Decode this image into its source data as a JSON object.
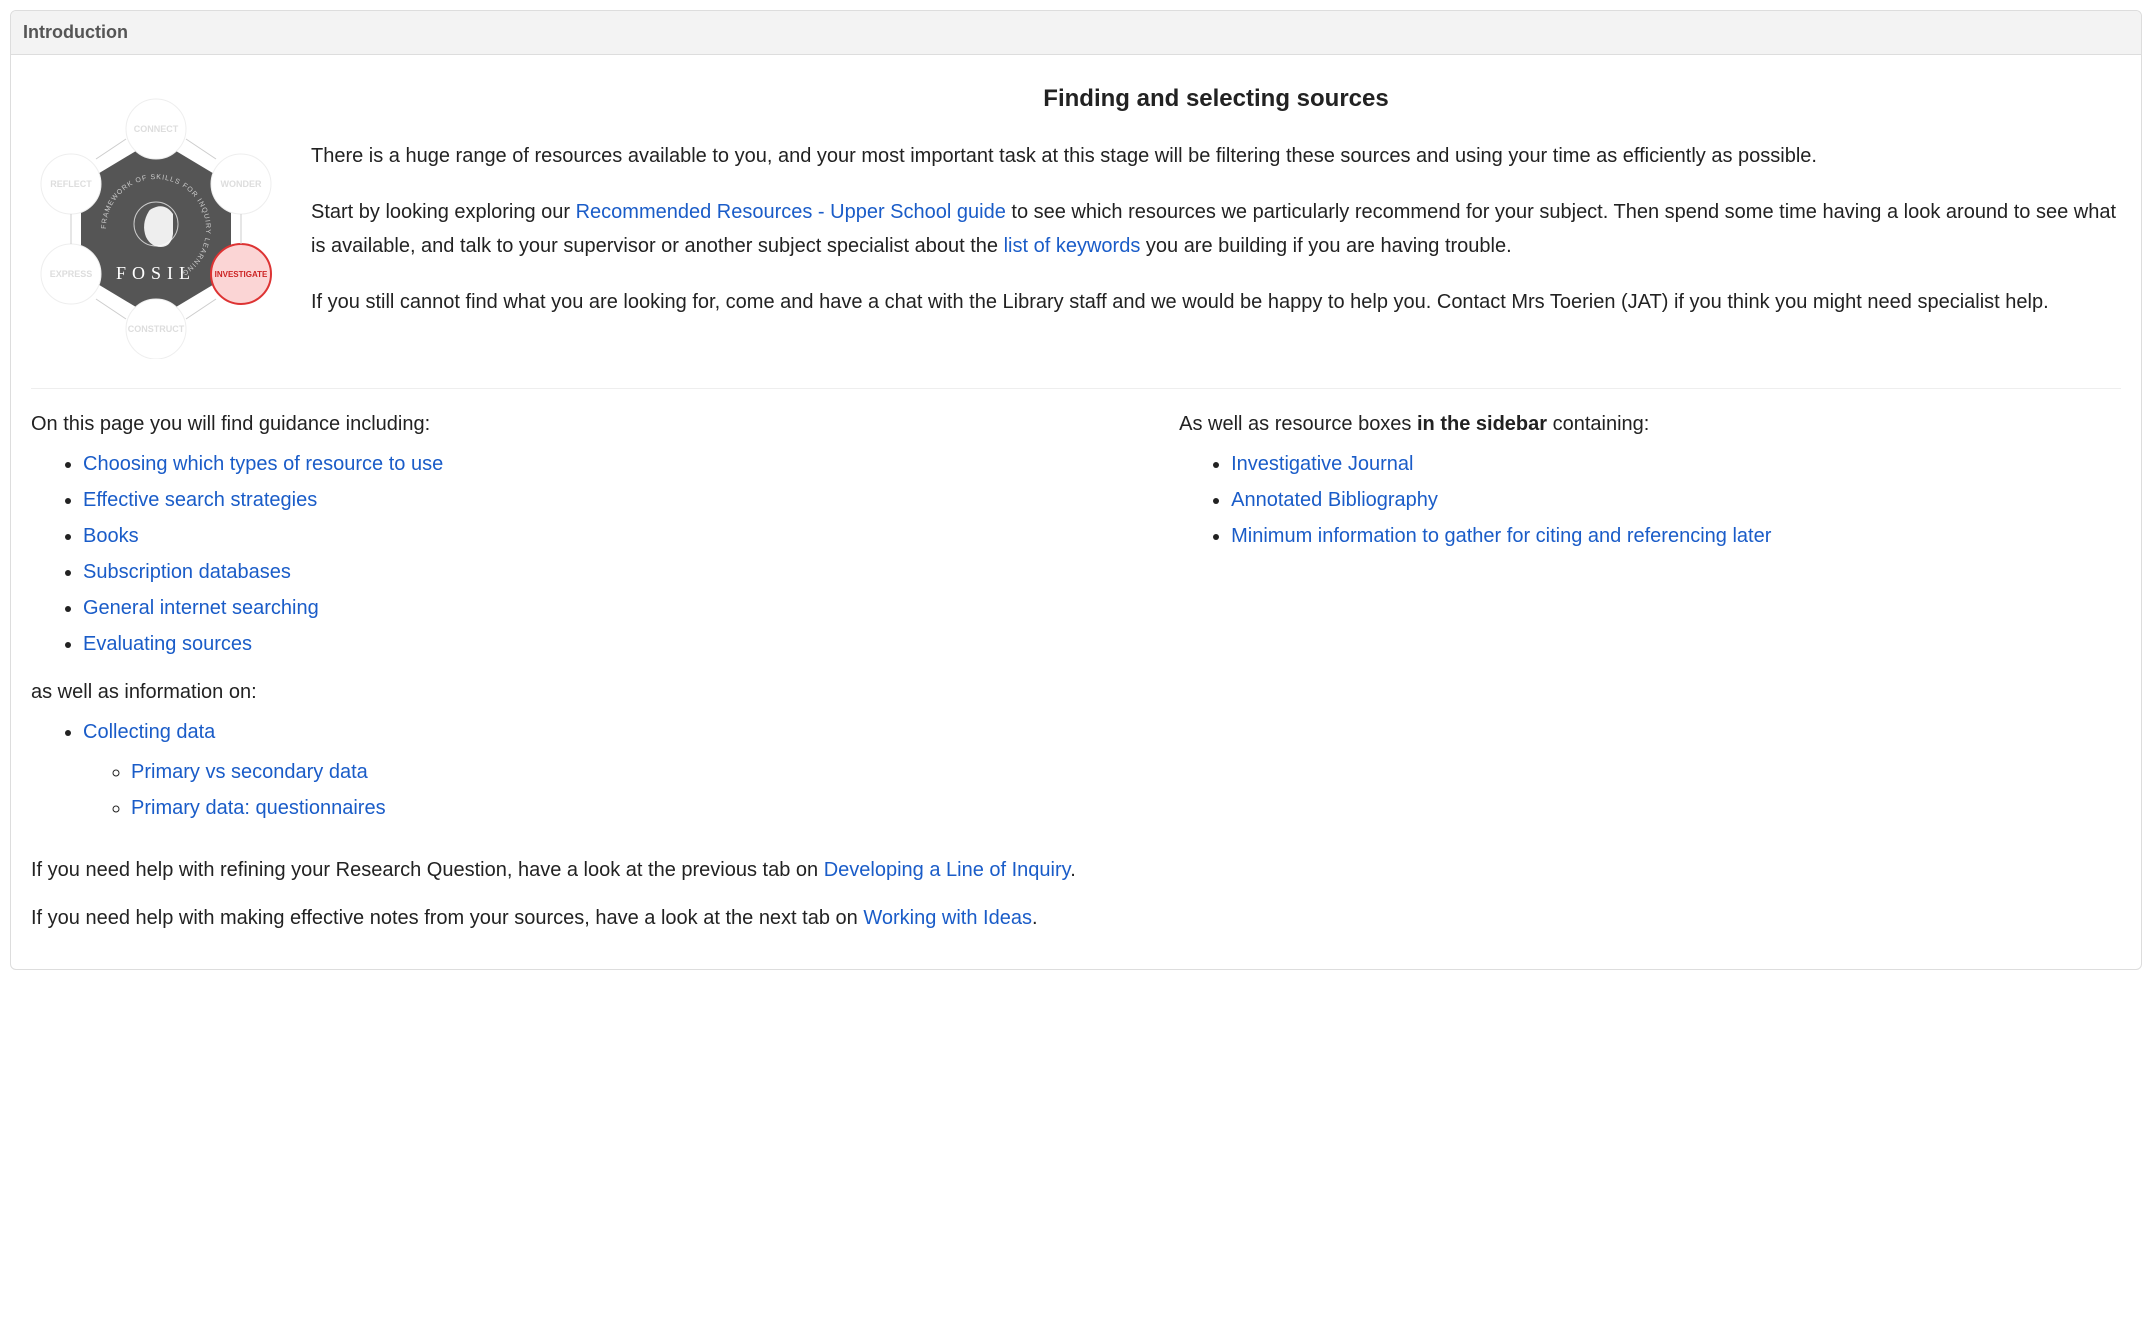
{
  "panel": {
    "title": "Introduction"
  },
  "heading": "Finding and selecting sources",
  "para1": "There is a huge range of resources available to you, and your most important task at this stage will be filtering these sources and using your time as efficiently as possible.",
  "para2a": "Start by looking exploring our ",
  "link_rec": "Recommended Resources - Upper School guide",
  "para2b": " to see which resources we particularly recommend for your subject. Then spend some time having a look around to see what is available, and talk to your supervisor or another subject specialist about the ",
  "link_keywords": "list of keywords",
  "para2c": " you are building if you are having trouble.",
  "para3": "If you still cannot find what you are looking for, come and have a chat with the Library staff and we would be happy to help you. Contact Mrs Toerien (JAT) if you think you might need specialist help.",
  "leftcol": {
    "intro1": "On this page you will find guidance including:",
    "links1": [
      "Choosing which types of resource to use",
      "Effective search strategies",
      "Books",
      "Subscription databases",
      "General internet searching",
      "Evaluating sources"
    ],
    "intro2": "as well as information on:",
    "links2_parent": "Collecting data",
    "links2_children": [
      "Primary vs secondary data",
      "Primary data: questionnaires"
    ]
  },
  "rightcol": {
    "intro_a": "As well as resource boxes ",
    "intro_b": "in the sidebar",
    "intro_c": " containing:",
    "links": [
      "Investigative Journal",
      "Annotated Bibliography",
      "Minimum information to gather for citing and referencing later"
    ]
  },
  "footer1a": "If you need help with refining your Research Question, have a look at the previous tab on ",
  "footer1_link": "Developing a Line of Inquiry",
  "footer1b": ".",
  "footer2a": "If you need help with making effective notes from your sources, have a look at the next tab on ",
  "footer2_link": "Working with Ideas",
  "footer2b": ".",
  "diagram": {
    "center": "FOSIL",
    "ring": "FRAMEWORK OF SKILLS FOR INQUIRY LEARNING",
    "nodes": {
      "connect": "CONNECT",
      "wonder": "WONDER",
      "investigate": "INVESTIGATE",
      "construct": "CONSTRUCT",
      "express": "EXPRESS",
      "reflect": "REFLECT"
    }
  }
}
